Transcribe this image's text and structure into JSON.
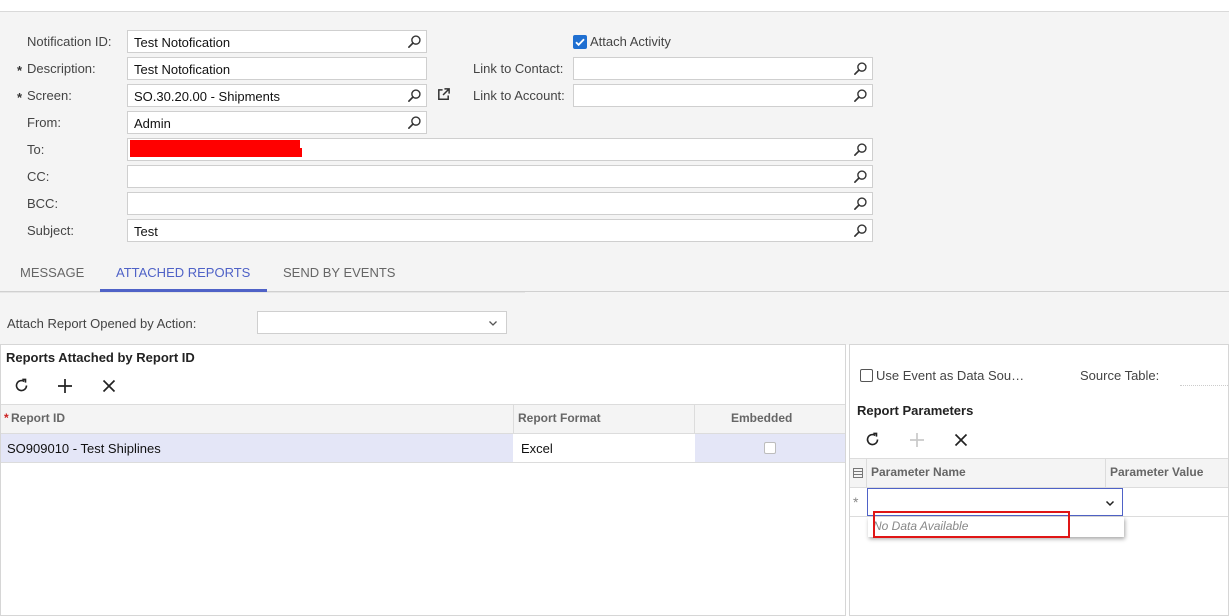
{
  "form": {
    "notification_id": {
      "label": "Notification ID:",
      "value": "Test Notofication"
    },
    "description": {
      "label": "Description:",
      "required": "*",
      "value": "Test Notofication"
    },
    "screen": {
      "label": "Screen:",
      "required": "*",
      "value": "SO.30.20.00 - Shipments"
    },
    "from": {
      "label": "From:",
      "value": "Admin"
    },
    "to": {
      "label": "To:",
      "value": ""
    },
    "cc": {
      "label": "CC:",
      "value": ""
    },
    "bcc": {
      "label": "BCC:",
      "value": ""
    },
    "subject": {
      "label": "Subject:",
      "value": "Test"
    },
    "attach_activity": {
      "label": "Attach Activity",
      "checked": true
    },
    "link_to_contact": {
      "label": "Link to Contact:",
      "value": ""
    },
    "link_to_account": {
      "label": "Link to Account:",
      "value": ""
    }
  },
  "tabs": [
    {
      "label": "MESSAGE",
      "active": false
    },
    {
      "label": "ATTACHED REPORTS",
      "active": true
    },
    {
      "label": "SEND BY EVENTS",
      "active": false
    }
  ],
  "attach_report_action": {
    "label": "Attach Report Opened by Action:",
    "value": ""
  },
  "reports_panel": {
    "title": "Reports Attached by Report ID",
    "columns": [
      "Report ID",
      "Report Format",
      "Embedded"
    ],
    "required_marker": "*",
    "rows": [
      {
        "report_id": "SO909010 - Test Shiplines",
        "format": "Excel",
        "embedded": false
      }
    ]
  },
  "params_panel": {
    "use_event_label": "Use Event as Data Sou…",
    "source_table_label": "Source Table:",
    "title": "Report Parameters",
    "columns": [
      "Parameter Name",
      "Parameter Value"
    ],
    "new_row_marker": "*",
    "dropdown_empty": "No Data Available"
  },
  "colors": {
    "accent": "#4f62c7",
    "selected_row": "#e4e6f7",
    "highlight_box": "#e01616",
    "redaction": "#ff0000"
  },
  "icons": [
    "search-icon",
    "external-link-icon",
    "refresh-icon",
    "add-icon",
    "delete-icon",
    "chevron-down-icon",
    "row-settings-icon"
  ]
}
